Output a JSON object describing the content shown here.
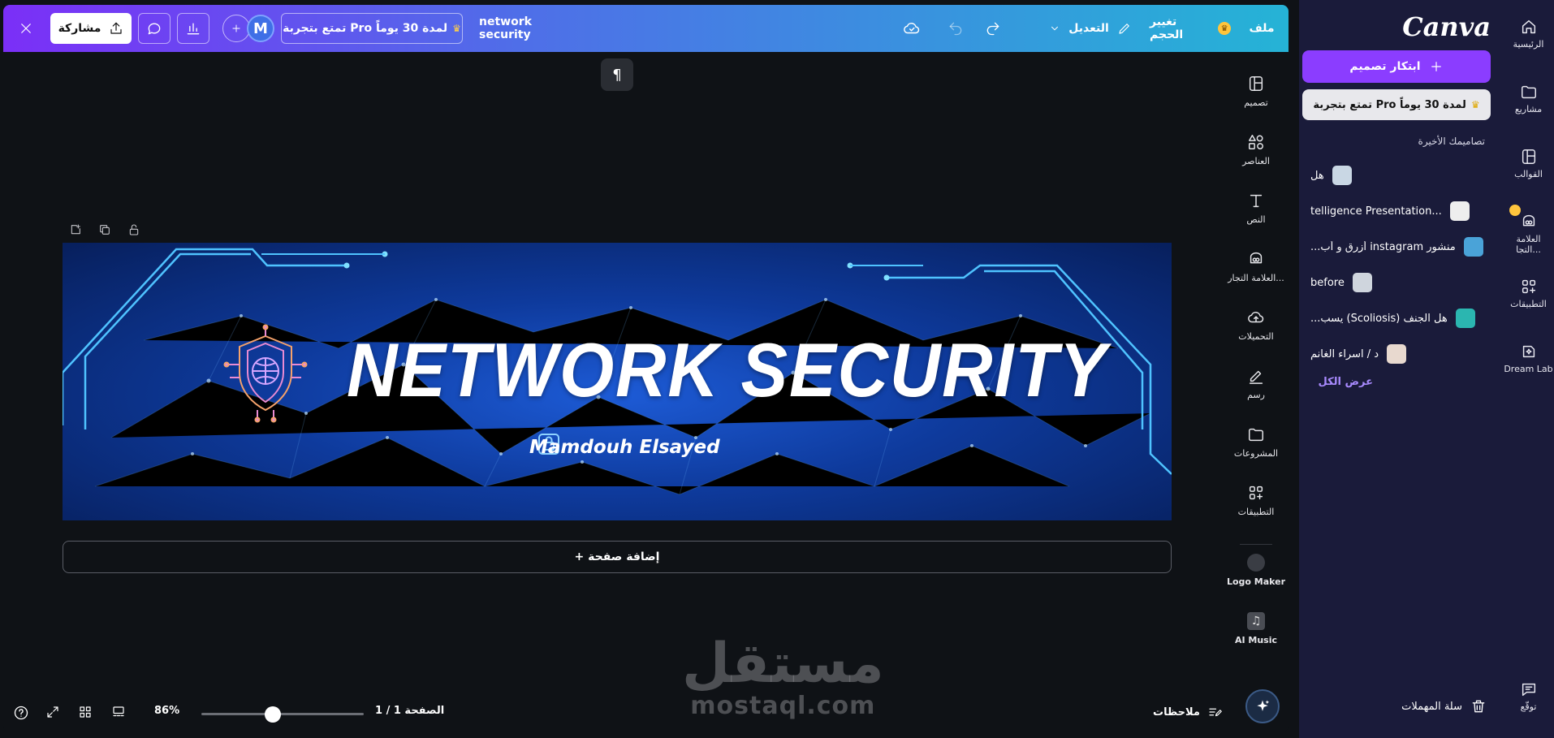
{
  "topbar": {
    "file_label": "ملف",
    "resize_label": "تغيير الحجم",
    "edit_label": "التعديل",
    "doc_title": "network security",
    "pro_trial": "تمتع بتجربة Pro لمدة 30 يوماً",
    "avatar_letter": "M",
    "share_label": "مشاركة"
  },
  "tools": [
    {
      "label": "تصميم",
      "icon": "layout-icon"
    },
    {
      "label": "العناصر",
      "icon": "shapes-icon"
    },
    {
      "label": "النص",
      "icon": "text-icon"
    },
    {
      "label": "العلامة التجار...",
      "icon": "brand-icon"
    },
    {
      "label": "التحميلات",
      "icon": "upload-cloud-icon"
    },
    {
      "label": "رسم",
      "icon": "draw-icon"
    },
    {
      "label": "المشروعات",
      "icon": "folder-icon"
    },
    {
      "label": "التطبيقات",
      "icon": "apps-icon"
    },
    {
      "label": "Logo Maker",
      "icon": "logo-maker-icon"
    },
    {
      "label": "AI Music",
      "icon": "music-icon"
    }
  ],
  "canvas": {
    "headline": "NETWORK SECURITY",
    "author": "Mamdouh Elsayed"
  },
  "add_page_label": "+ إضافة صفحة",
  "watermark": {
    "arabic": "مستقل",
    "latin": "mostaql.com"
  },
  "bottombar": {
    "notes_label": "ملاحظات",
    "page_indicator": "الصفحة 1 / 1",
    "zoom": "86%",
    "zoom_fraction": 0.44
  },
  "panel": {
    "brand": "Canva",
    "create_label": "ابتكار تصميم",
    "pro_trial": "تمتع بتجربة Pro لمدة 30 يوماً",
    "recent_heading": "تصاميمك الأخيرة",
    "recent": [
      {
        "title": "هل",
        "thumb_color": "#c9d7e4"
      },
      {
        "title": "telligence Presentation...",
        "thumb_color": "#eeeeee"
      },
      {
        "title": "منشور instagram أزرق و أب...",
        "thumb_color": "#4aa3d8"
      },
      {
        "title": "before",
        "thumb_color": "#cfd5dd"
      },
      {
        "title": "هل الجنف (Scoliosis) يسب...",
        "thumb_color": "#2bb6b0"
      },
      {
        "title": "د / اسراء الغانم",
        "thumb_color": "#e8d9cf"
      }
    ],
    "see_all": "عرض الكل",
    "trash_label": "سلة المهملات"
  },
  "rail": [
    {
      "label": "الرئيسية",
      "icon": "home-icon"
    },
    {
      "label": "مشاريع",
      "icon": "folder-icon"
    },
    {
      "label": "القوالب",
      "icon": "templates-icon"
    },
    {
      "label": "العلامة التجا...",
      "icon": "brand-icon"
    },
    {
      "label": "التطبيقات",
      "icon": "apps-icon"
    },
    {
      "label": "Dream Lab",
      "icon": "dream-lab-icon"
    },
    {
      "label": "توقّع",
      "icon": "feedback-icon"
    }
  ],
  "colors": {
    "accent": "#8b3dff",
    "panel_bg": "#1a1b3a",
    "canvas_bg": "#0f1216"
  }
}
